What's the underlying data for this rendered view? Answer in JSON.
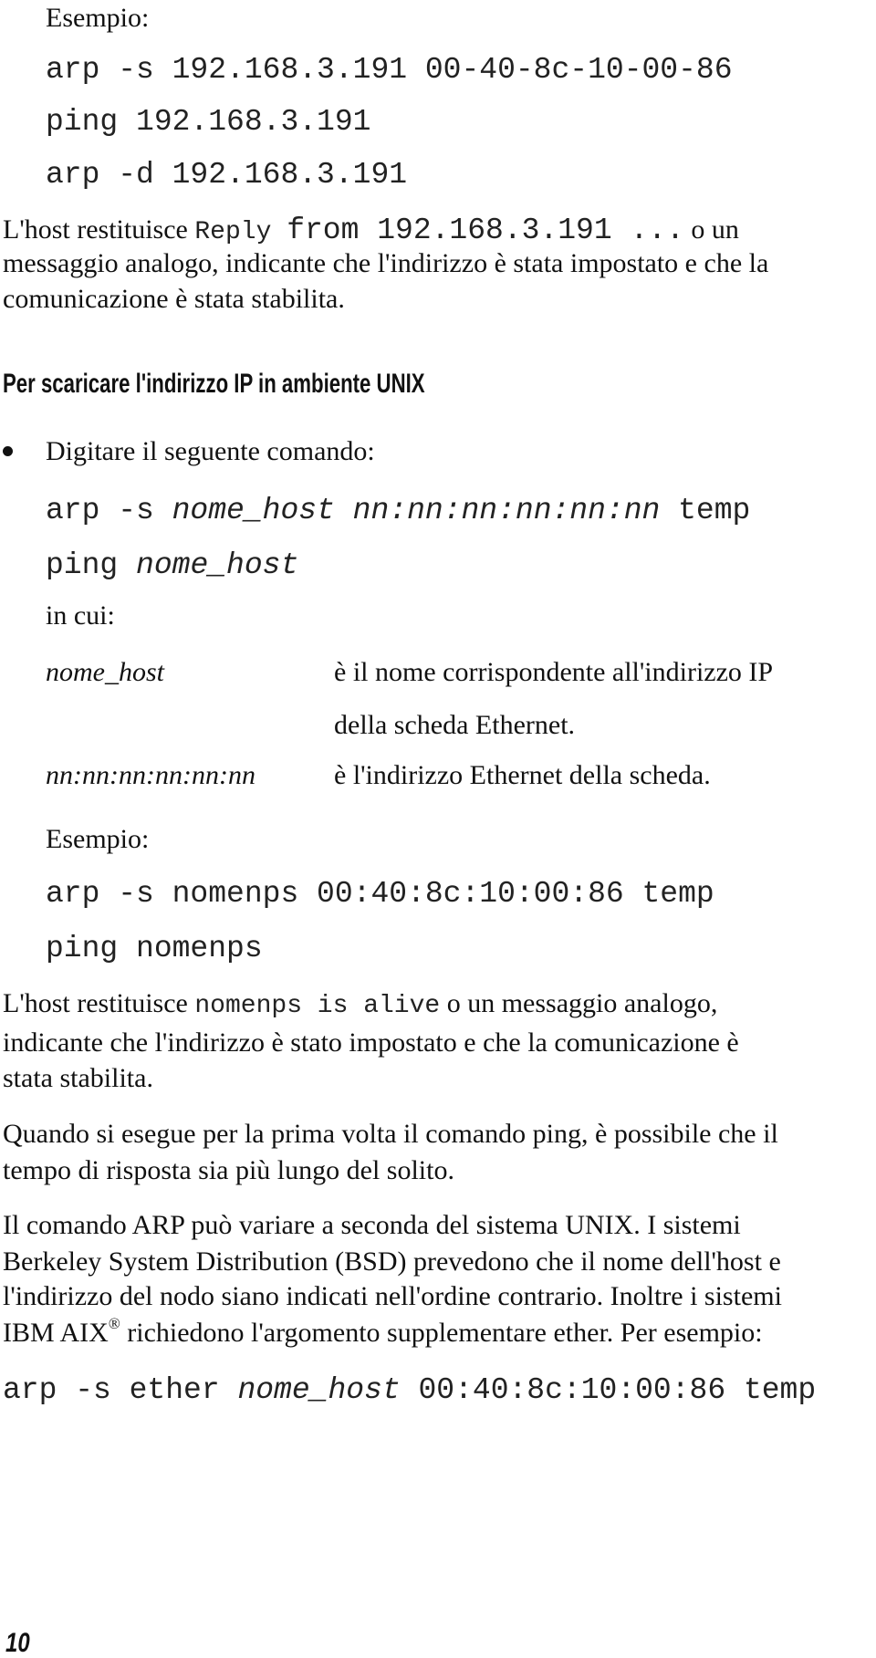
{
  "section1": {
    "example_label": "Esempio:",
    "commands": [
      "arp -s 192.168.3.191 00-40-8c-10-00-86",
      "ping 192.168.3.191",
      "arp -d 192.168.3.191"
    ],
    "result": {
      "prefix": "L'host restituisce ",
      "code_small": "Reply ",
      "code": "from 192.168.3.191 ...",
      "suffix": " o un",
      "line2": "messaggio analogo, indicante che l'indirizzo è stata impostato e che la",
      "line3": "comunicazione è stata stabilita."
    }
  },
  "section2": {
    "heading": "Per scaricare l'indirizzo IP in ambiente UNIX",
    "bullet_text": "Digitare il seguente comando:",
    "command1": {
      "cmd": "arp -s ",
      "arg1": "nome_host",
      "sep": " ",
      "arg2": "nn:nn:nn:nn:nn:nn",
      "tail": " temp"
    },
    "command2": {
      "cmd": "ping ",
      "arg1": "nome_host"
    },
    "where_label": "in cui:",
    "definitions": [
      {
        "term": "nome_host",
        "desc_line1": "è il nome corrispondente all'indirizzo IP",
        "desc_line2": "della scheda Ethernet."
      },
      {
        "term": "nn:nn:nn:nn:nn:nn",
        "desc_line1": "è l'indirizzo Ethernet della scheda."
      }
    ],
    "example_label": "Esempio:",
    "example_commands": [
      "arp -s nomenps 00:40:8c:10:00:86 temp",
      "ping nomenps"
    ],
    "result": {
      "prefix": "L'host restituisce ",
      "code": "nomenps is alive",
      "suffix": " o un messaggio analogo,",
      "line2": "indicante che l'indirizzo è stato impostato e che la comunicazione è",
      "line3": "stata stabilita."
    },
    "note_ping": {
      "line1": "Quando si esegue per la prima volta il comando ping, è possibile che il",
      "line2": "tempo di risposta sia più lungo del solito."
    },
    "note_arp": {
      "line1": "Il comando ARP può variare a seconda del sistema UNIX. I sistemi",
      "line2": "Berkeley System Distribution (BSD) prevedono che il nome dell'host e",
      "line3": "l'indirizzo del nodo siano indicati nell'ordine contrario. Inoltre i sistemi",
      "line4_pre": "IBM AIX",
      "line4_sup": "®",
      "line4_post": " richiedono l'argomento supplementare ether. Per esempio:"
    },
    "aix_command": {
      "cmd": "arp -s ether ",
      "arg1": "nome_host",
      "tail": " 00:40:8c:10:00:86 temp"
    }
  },
  "footer": {
    "page_number": "10"
  }
}
